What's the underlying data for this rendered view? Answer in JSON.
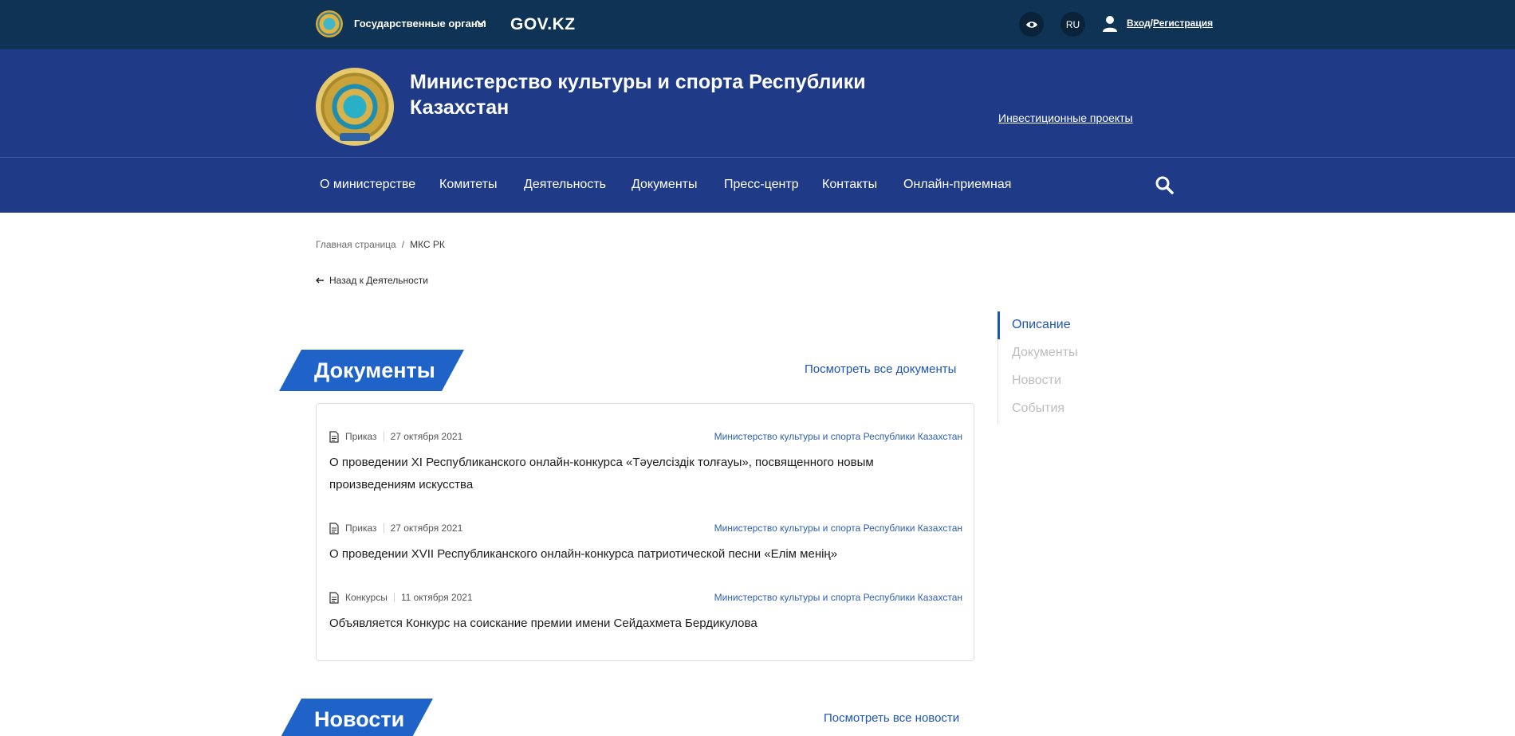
{
  "topbar": {
    "gov_organs": "Государственные органы",
    "govkz": "GOV.KZ",
    "lang": "RU",
    "login": "Вход",
    "auth_sep": "/",
    "register": "Регистрация"
  },
  "header": {
    "ministry_title": "Министерство культуры и спорта Республики Казахстан",
    "invest_link": "Инвестиционные проекты"
  },
  "nav": {
    "items": [
      "О министерстве",
      "Комитеты",
      "Деятельность",
      "Документы",
      "Пресс-центр",
      "Контакты",
      "Онлайн-приемная"
    ]
  },
  "breadcrumb": {
    "home": "Главная страница",
    "sep": "/",
    "current": "МКС РК"
  },
  "back_link": "Назад к Деятельности",
  "documents_section": {
    "title": "Документы",
    "see_all": "Посмотреть все документы",
    "items": [
      {
        "type": "Приказ",
        "date": "27 октября 2021",
        "org": "Министерство культуры и спорта Республики Казахстан",
        "title": "О проведении XI Республиканского онлайн-конкурса «Тәуелсіздік толғауы», посвященного новым произведениям искусства"
      },
      {
        "type": "Приказ",
        "date": "27 октября 2021",
        "org": "Министерство культуры и спорта Республики Казахстан",
        "title": "О проведении XVII Республиканского онлайн-конкурса патриотической песни «Елім менің»"
      },
      {
        "type": "Конкурсы",
        "date": "11 октября 2021",
        "org": "Министерство культуры и спорта Республики Казахстан",
        "title": "Объявляется Конкурс на соискание премии имени Сейдахмета Бердикулова"
      }
    ]
  },
  "news_section": {
    "title": "Новости",
    "see_all": "Посмотреть все новости"
  },
  "side_menu": {
    "items": [
      "Описание",
      "Документы",
      "Новости",
      "События"
    ],
    "active": "Описание"
  },
  "colors": {
    "topbar": "#0e3355",
    "header": "#1f3b87",
    "accent": "#1f63c8",
    "link": "#1f56b5"
  }
}
